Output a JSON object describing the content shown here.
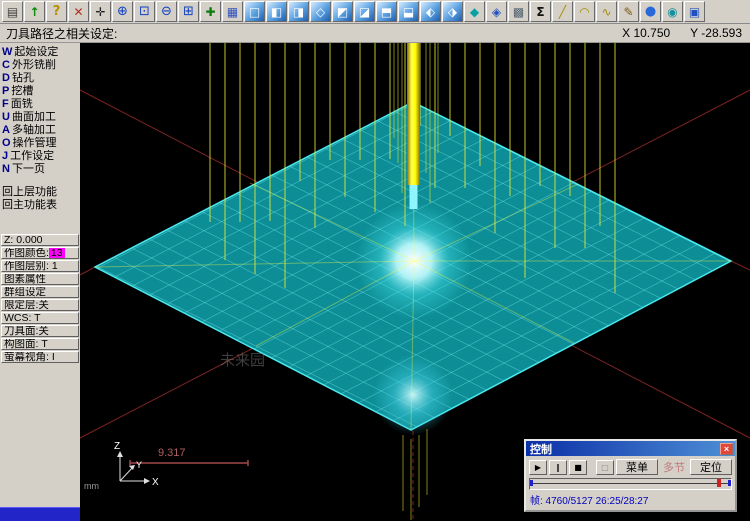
{
  "toolbar": {
    "icons": [
      {
        "name": "print-icon",
        "glyph": "▤",
        "style": "color:#404040"
      },
      {
        "name": "back-icon",
        "glyph": "↑",
        "style": "color:#0c8a0c;font-weight:bold"
      },
      {
        "name": "help-icon",
        "glyph": "?",
        "style": "color:#b89000;font-weight:bold;font-size:13px"
      },
      {
        "name": "delete-icon",
        "glyph": "✕",
        "style": "color:#b03020;font-weight:bold"
      },
      {
        "name": "pointer-icon",
        "glyph": "✛",
        "style": "color:#202020"
      },
      {
        "name": "zoom-in-icon",
        "glyph": "⊕",
        "style": "color:#1040c0;font-size:13px"
      },
      {
        "name": "zoom-window-icon",
        "glyph": "⊡",
        "style": "color:#1040c0;font-size:13px"
      },
      {
        "name": "zoom-out-icon",
        "glyph": "⊖",
        "style": "color:#1040c0;font-size:13px"
      },
      {
        "name": "zoom-fit-icon",
        "glyph": "⊞",
        "style": "color:#1040c0;font-size:13px"
      },
      {
        "name": "pan-icon",
        "glyph": "✚",
        "style": "color:#0c7a0c"
      },
      {
        "name": "repaint-icon",
        "glyph": "▦",
        "style": "color:#3050c0"
      },
      {
        "name": "gview-top-icon",
        "glyph": "□",
        "style": "color:#ffffff;background:linear-gradient(135deg,#d6ecff 0%,#5aa0e0 55%,#1f5fb0 100%)"
      },
      {
        "name": "gview-front-icon",
        "glyph": "◧",
        "style": "color:#ffffff;background:linear-gradient(135deg,#d6ecff 0%,#5aa0e0 55%,#1f5fb0 100%)"
      },
      {
        "name": "gview-side-icon",
        "glyph": "◨",
        "style": "color:#ffffff;background:linear-gradient(135deg,#d6ecff 0%,#5aa0e0 55%,#1f5fb0 100%)"
      },
      {
        "name": "gview-iso-icon",
        "glyph": "◇",
        "style": "color:#ffffff;background:linear-gradient(135deg,#d6ecff 0%,#5aa0e0 55%,#1f5fb0 100%)"
      },
      {
        "name": "gview-back-icon",
        "glyph": "◩",
        "style": "color:#ffffff;background:linear-gradient(135deg,#d6ecff 0%,#5aa0e0 55%,#1f5fb0 100%)"
      },
      {
        "name": "gview-bottom-icon",
        "glyph": "◪",
        "style": "color:#ffffff;background:linear-gradient(135deg,#d6ecff 0%,#5aa0e0 55%,#1f5fb0 100%)"
      },
      {
        "name": "cplane-top-icon",
        "glyph": "⬒",
        "style": "color:#ffffff;background:linear-gradient(135deg,#d6ecff 0%,#5aa0e0 55%,#1f5fb0 100%)"
      },
      {
        "name": "cplane-front-icon",
        "glyph": "⬓",
        "style": "color:#ffffff;background:linear-gradient(135deg,#d6ecff 0%,#5aa0e0 55%,#1f5fb0 100%)"
      },
      {
        "name": "cplane-side-icon",
        "glyph": "⬖",
        "style": "color:#ffffff;background:linear-gradient(135deg,#d6ecff 0%,#5aa0e0 55%,#1f5fb0 100%)"
      },
      {
        "name": "cplane-iso-icon",
        "glyph": "⬗",
        "style": "color:#ffffff;background:linear-gradient(135deg,#d6ecff 0%,#5aa0e0 55%,#1f5fb0 100%)"
      },
      {
        "name": "shade-icon",
        "glyph": "◆",
        "style": "color:#0aa0a8"
      },
      {
        "name": "wireframe-icon",
        "glyph": "◈",
        "style": "color:#2050c0"
      },
      {
        "name": "grid-icon",
        "glyph": "▩",
        "style": "color:#506070"
      },
      {
        "name": "stats-icon",
        "glyph": "Σ",
        "style": "color:#101010;font-weight:bold"
      },
      {
        "name": "line-icon",
        "glyph": "╱",
        "style": "color:#a09000"
      },
      {
        "name": "arc-icon",
        "glyph": "◠",
        "style": "color:#a09000"
      },
      {
        "name": "spline-icon",
        "glyph": "∿",
        "style": "color:#a09000"
      },
      {
        "name": "pencil-icon",
        "glyph": "✎",
        "style": "color:#7a5a10"
      },
      {
        "name": "sphere-icon",
        "glyph": "●",
        "style": "color:#2868d8;font-size:13px"
      },
      {
        "name": "surface-icon",
        "glyph": "◉",
        "style": "color:#15909c"
      },
      {
        "name": "solid-icon",
        "glyph": "▣",
        "style": "color:#2050c0"
      }
    ]
  },
  "prompt": {
    "text": "刀具路径之相关设定:",
    "coord_x": "X 10.750",
    "coord_y": "Y -28.593"
  },
  "sidebar": {
    "menu": [
      {
        "key": "W",
        "label": "起始设定",
        "name": "menu-item-start-settings"
      },
      {
        "key": "C",
        "label": "外形铣削",
        "name": "menu-item-contour"
      },
      {
        "key": "D",
        "label": "钻孔",
        "name": "menu-item-drill"
      },
      {
        "key": "P",
        "label": "挖槽",
        "name": "menu-item-pocket"
      },
      {
        "key": "F",
        "label": "面铣",
        "name": "menu-item-face-mill"
      },
      {
        "key": "U",
        "label": "曲面加工",
        "name": "menu-item-surface-machining"
      },
      {
        "key": "A",
        "label": "多轴加工",
        "name": "menu-item-multiaxis"
      },
      {
        "key": "O",
        "label": "操作管理",
        "name": "menu-item-operations"
      },
      {
        "key": "J",
        "label": "工作设定",
        "name": "menu-item-job-setup"
      },
      {
        "key": "N",
        "label": "下一页",
        "name": "menu-item-next-page"
      }
    ],
    "nav": [
      {
        "label": "回上层功能",
        "name": "menu-item-back-level"
      },
      {
        "label": "回主功能表",
        "name": "menu-item-main-menu"
      }
    ],
    "z_value": "Z:  0.000",
    "color_label": "作图颜色:",
    "color_value": "13",
    "settings": [
      {
        "label": "作图层别: 1",
        "name": "status-layer"
      },
      {
        "label": "图素属性",
        "name": "status-attributes"
      },
      {
        "label": "群组设定",
        "name": "status-groups"
      },
      {
        "label": "限定层:关",
        "name": "status-limit-layer"
      },
      {
        "label": "WCS: T",
        "name": "status-wcs"
      },
      {
        "label": "刀具面:关",
        "name": "status-tool-plane"
      },
      {
        "label": "构图面: T",
        "name": "status-cplane"
      },
      {
        "label": "萤幕视角: I",
        "name": "status-gview"
      }
    ]
  },
  "viewport": {
    "axis_x": "X",
    "axis_y": "Y",
    "axis_z": "Z",
    "ruler_value": "9.317",
    "unit_label": "mm",
    "watermark": "未来园"
  },
  "control": {
    "title": "控制",
    "close_glyph": "×",
    "play_glyph": "▶",
    "pause_glyph": "‖",
    "stop_glyph": "■",
    "step_glyph": "□",
    "menu_label": "菜单",
    "mode_label": "多节",
    "locate_label": "定位",
    "status": "帧: 4760/5127   26:25/28:27",
    "progress_pct": "93"
  }
}
